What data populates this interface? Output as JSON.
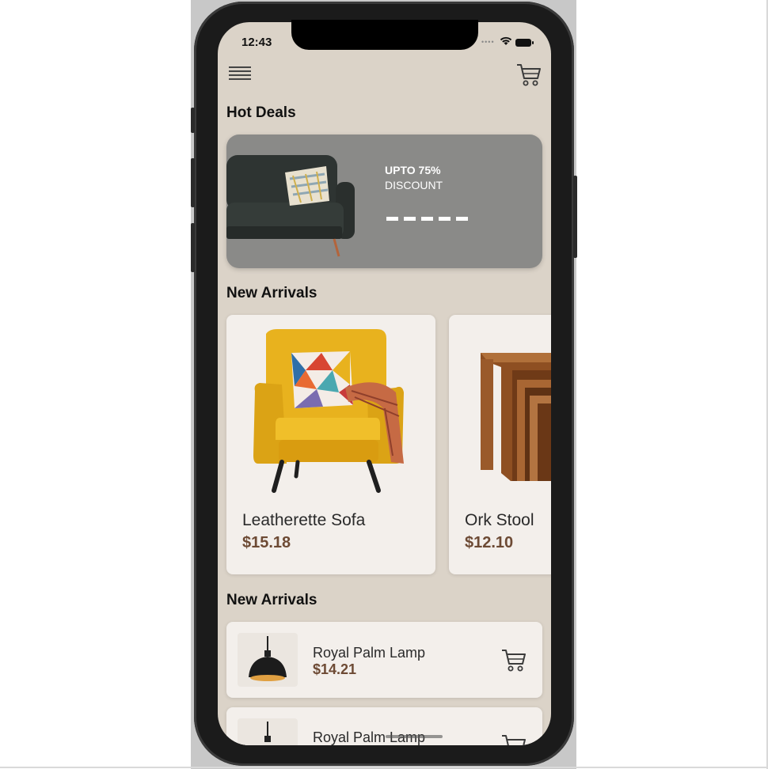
{
  "status_bar": {
    "time": "12:43"
  },
  "sections": {
    "hot_deals_title": "Hot Deals",
    "new_arrivals_title": "New Arrivals",
    "new_arrivals_list_title": "New Arrivals"
  },
  "deal": {
    "line1": "UPTO 75%",
    "line2": "DISCOUNT"
  },
  "products": [
    {
      "name": "Leatherette Sofa",
      "price": "$15.18"
    },
    {
      "name": "Ork Stool",
      "price": "$12.10"
    }
  ],
  "list_items": [
    {
      "name": "Royal Palm Lamp",
      "price": "$14.21"
    },
    {
      "name": "Royal Palm Lamp",
      "price": ""
    }
  ],
  "colors": {
    "background": "#dbd3c8",
    "card": "#f3efeb",
    "deal_banner": "#8a8a88",
    "price": "#6d4a34"
  },
  "icons": [
    "menu-icon",
    "cart-icon",
    "wifi-icon",
    "battery-icon"
  ]
}
